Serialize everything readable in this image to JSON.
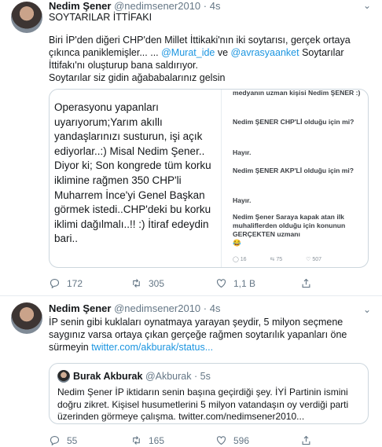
{
  "tweet1": {
    "name": "Nedim Şener",
    "handle": "@nedimsener2010",
    "dot": "·",
    "time": "4s",
    "title": "SOYTARILAR İTTİFAKI",
    "body_part1": "Biri İP'den diğeri CHP'den Millet İttikaki'nın iki soytarısı, gerçek ortaya çıkınca paniklemişler... ... ",
    "mention1": "@Murat_ide",
    "body_and": " ve ",
    "mention2": "@avrasyaanket",
    "body_part2": " Soytarılar İttifakı'nı oluşturup bana saldırıyor.",
    "body_line3": "Soytarılar siz gidin ağababalarınız gelsin",
    "media_left_text": "Operasyonu yapanları uyarıyorum;Yarım akıllı yandaşlarınızı susturun, işi açık ediyorlar..:) Misal Nedim Şener.. Diyor ki; Son kongrede tüm korku iklimine rağmen 350 CHP'li Muharrem İnce'yi Genel Başkan görmek istedi..CHP'deki bu korku iklimi dağılmalı..!! :) İtiraf edeydin bari..",
    "media_right": {
      "line1": "medyanın uzman kişisi Nedim ŞENER :)",
      "line2": "Nedim ŞENER CHP'Lİ olduğu için mi?",
      "line3": "Hayır.",
      "line4": "Nedim ŞENER AKP'Lİ olduğu için mi?",
      "line5": "Hayır.",
      "line6": "Nedim Şener Saraya kapak atan ilk muhaliflerden olduğu için konunun GERÇEKTEN uzmanı",
      "emoji": "😂",
      "mini_replies": "16",
      "mini_retweets": "75",
      "mini_likes": "507"
    },
    "replies": "172",
    "retweets": "305",
    "likes": "1,1 B"
  },
  "tweet2": {
    "name": "Nedim Şener",
    "handle": "@nedimsener2010",
    "dot": "·",
    "time": "4s",
    "body": "İP senin gibi kuklaları oynatmaya yarayan şeydir, 5 milyon seçmene saygınız varsa ortaya çıkan gerçeğe rağmen soytarılık yapanları öne sürmeyin ",
    "link": "twitter.com/akburak/status...",
    "quote": {
      "name": "Burak Akburak",
      "handle": "@Akburak",
      "dot": "·",
      "time": "5s",
      "text": "Nedim Şener İP iktidarın senin başına geçirdiği şey. İYİ Partinin ismini doğru zikret. Kişisel husumetlerini 5 milyon vatandaşın oy verdiği parti üzerinden görmeye çalışma. twitter.com/nedimsener2010..."
    },
    "replies": "55",
    "retweets": "165",
    "likes": "596"
  },
  "icons": {
    "reply": "reply-icon",
    "retweet": "retweet-icon",
    "like": "heart-icon",
    "share": "share-icon",
    "caret": "chevron-down-icon"
  },
  "colors": {
    "link": "#1b95e0",
    "secondary": "#657786",
    "border": "#ccd6dd"
  }
}
